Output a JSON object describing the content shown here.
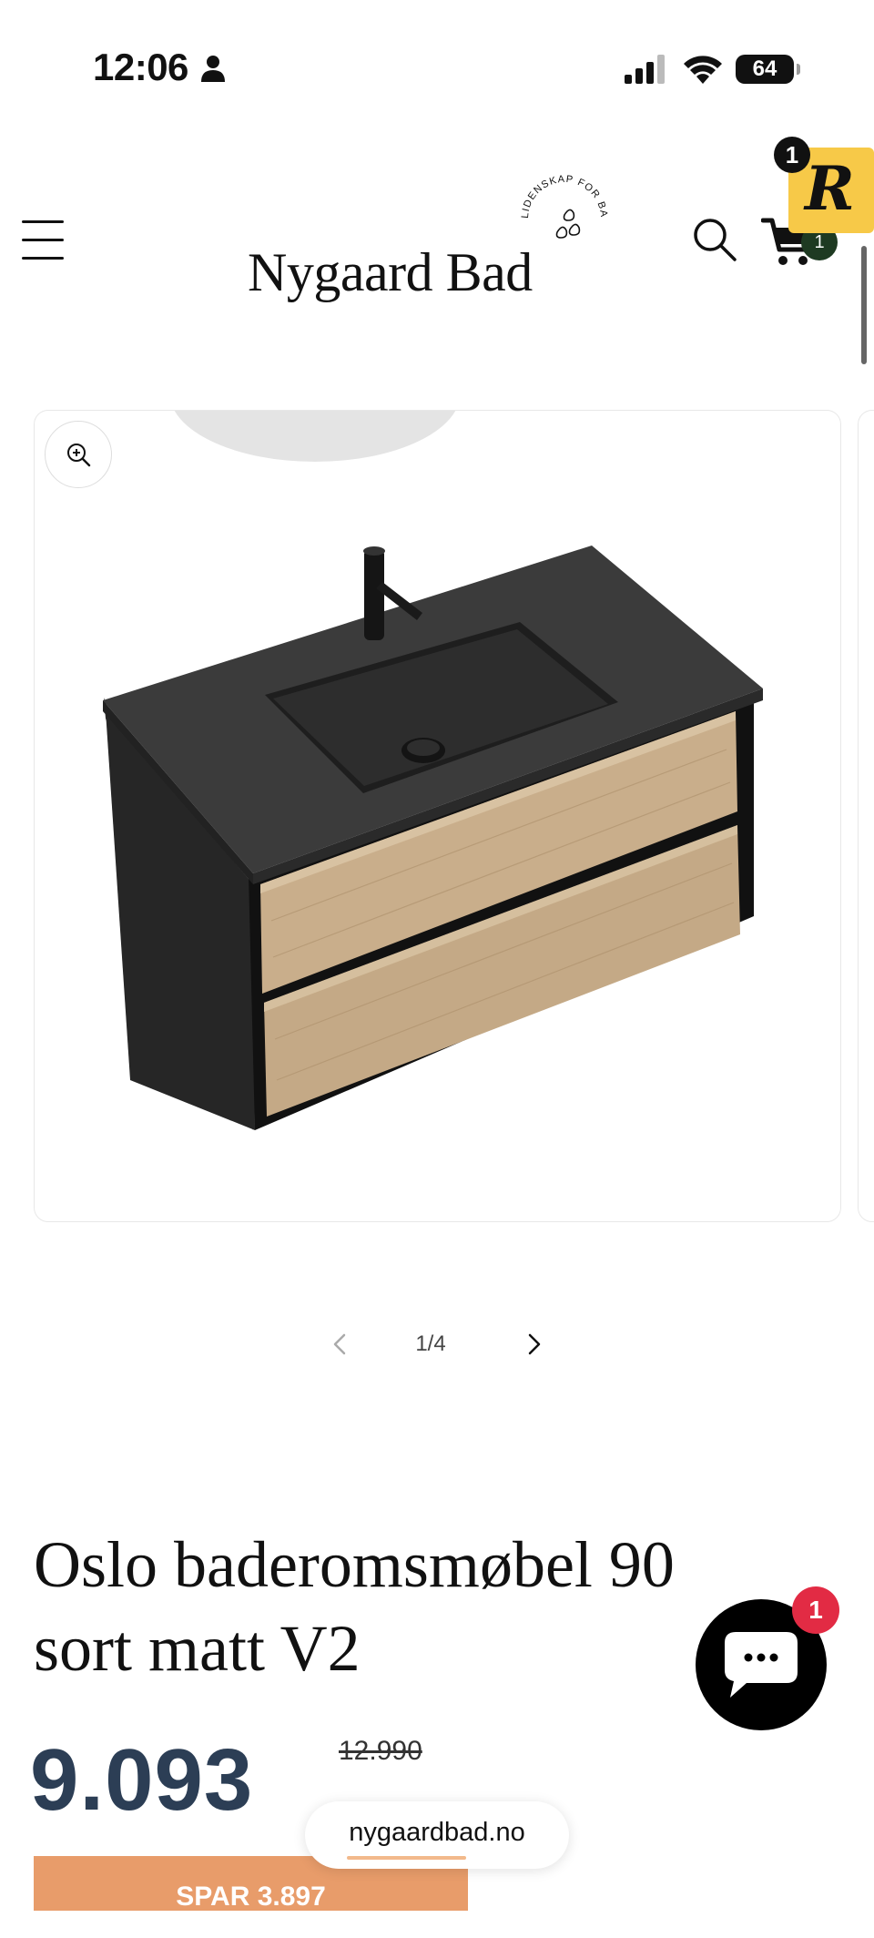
{
  "status_bar": {
    "time": "12:06",
    "battery": "64"
  },
  "header": {
    "logo_text": "Nygaard Bad",
    "logo_tagline": "LIDENSKAP FOR BADEROM",
    "cart_count": "1",
    "rewards_badge": "1",
    "rewards_letter": "R"
  },
  "gallery": {
    "current": "1/4"
  },
  "product": {
    "title": "Oslo baderomsmøbel 90 sort matt V2",
    "price": "9.093",
    "compare_price": "12.990",
    "save_label": "SPAR 3.897"
  },
  "chat": {
    "badge": "1"
  },
  "browser": {
    "url": "nygaardbad.no",
    "load_progress": 0.45
  },
  "colors": {
    "price": "#2c3e55",
    "save_badge": "#e89c6a",
    "chat_badge": "#e22b44",
    "rewards_bg": "#f7c948"
  }
}
